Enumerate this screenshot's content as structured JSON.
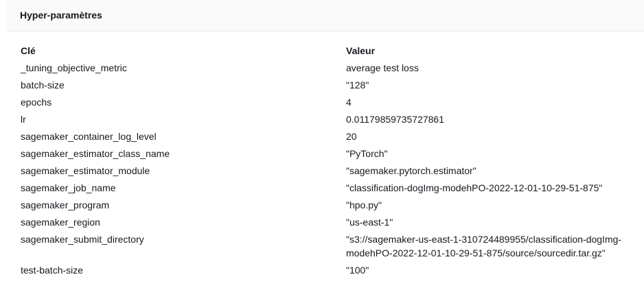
{
  "panel": {
    "title": "Hyper-paramètres"
  },
  "table": {
    "columns": [
      "Clé",
      "Valeur"
    ],
    "rows": [
      {
        "key": "_tuning_objective_metric",
        "value": "average test loss"
      },
      {
        "key": "batch-size",
        "value": "\"128\""
      },
      {
        "key": "epochs",
        "value": "4"
      },
      {
        "key": "lr",
        "value": "0.01179859735727861"
      },
      {
        "key": "sagemaker_container_log_level",
        "value": "20"
      },
      {
        "key": "sagemaker_estimator_class_name",
        "value": "\"PyTorch\""
      },
      {
        "key": "sagemaker_estimator_module",
        "value": "\"sagemaker.pytorch.estimator\""
      },
      {
        "key": "sagemaker_job_name",
        "value": "\"classification-dogImg-modehPO-2022-12-01-10-29-51-875\""
      },
      {
        "key": "sagemaker_program",
        "value": "\"hpo.py\""
      },
      {
        "key": "sagemaker_region",
        "value": "\"us-east-1\""
      },
      {
        "key": "sagemaker_submit_directory",
        "value_line1": "\"s3://sagemaker-us-east-1-310724489955/classification-dogImg-",
        "value_line2": "modehPO-2022-12-01-10-29-51-875/source/sourcedir.tar.gz\""
      },
      {
        "key": "test-batch-size",
        "value": "\"100\""
      }
    ]
  }
}
